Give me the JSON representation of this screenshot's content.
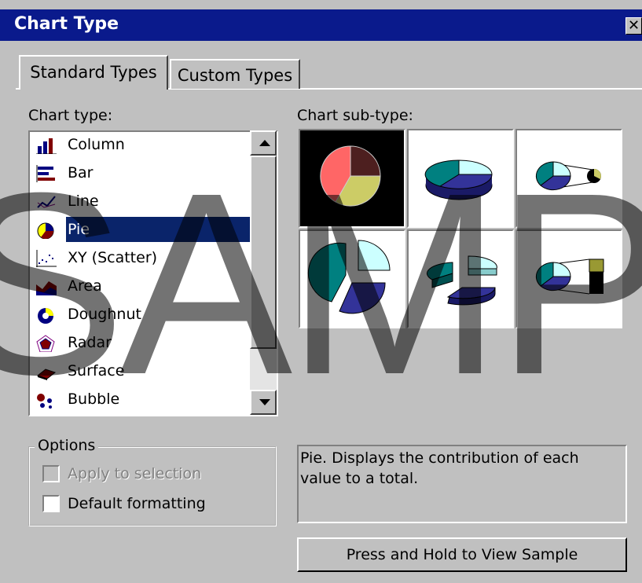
{
  "dialog": {
    "title": "Chart Type",
    "close_icon": "close-icon"
  },
  "tabs": [
    {
      "label": "Standard Types",
      "selected": true
    },
    {
      "label": "Custom Types",
      "selected": false
    }
  ],
  "chart_type": {
    "label": "Chart type:",
    "items": [
      {
        "label": "Column",
        "icon": "column-chart-icon"
      },
      {
        "label": "Bar",
        "icon": "bar-chart-icon"
      },
      {
        "label": "Line",
        "icon": "line-chart-icon"
      },
      {
        "label": "Pie",
        "icon": "pie-chart-icon",
        "selected": true
      },
      {
        "label": "XY (Scatter)",
        "icon": "scatter-chart-icon"
      },
      {
        "label": "Area",
        "icon": "area-chart-icon"
      },
      {
        "label": "Doughnut",
        "icon": "doughnut-chart-icon"
      },
      {
        "label": "Radar",
        "icon": "radar-chart-icon"
      },
      {
        "label": "Surface",
        "icon": "surface-chart-icon"
      },
      {
        "label": "Bubble",
        "icon": "bubble-chart-icon"
      }
    ]
  },
  "subtype": {
    "label": "Chart sub-type:",
    "selected_index": 0
  },
  "options": {
    "legend": "Options",
    "apply_label": "Apply to selection",
    "apply_checked": false,
    "apply_disabled": true,
    "default_label": "Default formatting",
    "default_checked": false
  },
  "description": "Pie. Displays the contribution of each value to a total.",
  "view_sample_button": "Press and Hold to View Sample",
  "watermark": "SAMP",
  "colors": {
    "titlebar": "#0a1a8c",
    "selection": "#0a246a",
    "pie_teal": "#008080",
    "pie_navy": "#333399",
    "pie_light": "#ccffff",
    "pie_salmon": "#ff6666",
    "pie_brown": "#4d1f1f",
    "pie_olive": "#cccc66"
  }
}
